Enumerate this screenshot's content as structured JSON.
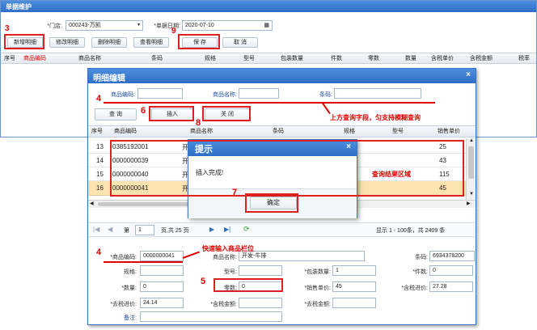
{
  "window": {
    "title": "单据维护"
  },
  "form": {
    "store_label": "*门店:",
    "store_value": "000243-万凯",
    "date_label": "*单据日期:",
    "date_value": "2020-07-10"
  },
  "toolbar": [
    "新增明细",
    "修改明细",
    "删除明细",
    "查看明细",
    "保 存",
    "取 消"
  ],
  "main_table": {
    "headers": [
      "序号",
      "商品编码",
      "商品名称",
      "条码",
      "规格",
      "型号",
      "包装数量",
      "件数",
      "零数",
      "数量",
      "含税单价",
      "含税金额",
      "税率"
    ]
  },
  "dialog": {
    "title": "明细编辑",
    "search": {
      "code_label": "商品编码:",
      "name_label": "商品名称:",
      "barcode_label": "条码:"
    },
    "buttons": {
      "query": "查 询",
      "insert": "插入",
      "close": "关 闭"
    },
    "table": {
      "headers": [
        "序号",
        "商品编码",
        "商品名称",
        "条码",
        "规格",
        "型号",
        "销售单价"
      ],
      "rows": [
        {
          "no": "13",
          "code": "0385192001",
          "name": "开",
          "price": "25"
        },
        {
          "no": "14",
          "code": "0000000039",
          "name": "开",
          "price": "43"
        },
        {
          "no": "15",
          "code": "0000000040",
          "name": "开",
          "price": "115"
        },
        {
          "no": "16",
          "code": "0000000041",
          "name": "开",
          "price": "45"
        }
      ]
    },
    "pager": {
      "page_prefix": "第",
      "page_value": "1",
      "page_suffix": "页,共 25 页",
      "info": "显示 1 - 100条，共 2409 条"
    },
    "detail": {
      "code_label": "*商品编码:",
      "code_value": "0000000041",
      "name_label": "商品名称:",
      "name_value": "开发-牛排",
      "barcode_label": "条码:",
      "barcode_value": "6934378200",
      "spec_label": "规格:",
      "spec_value": "",
      "model_label": "型号:",
      "model_value": "",
      "pack_label": "*包装数量:",
      "pack_value": "1",
      "pieces_label": "*件数:",
      "pieces_value": "0",
      "qty_label": "*数量:",
      "qty_value": "0",
      "loose_label": "零数:",
      "loose_value": "0",
      "price_label": "*销售单价:",
      "price_value": "45",
      "taxprice_label": "*含税进价:",
      "taxprice_value": "27.28",
      "notaxprice_label": "*去税进价:",
      "notaxprice_value": "24.14",
      "taxamt_label": "*含税金额:",
      "taxamt_value": "",
      "notaxamt_label": "*去税金额:",
      "notaxamt_value": "",
      "note_label": "备注:",
      "note_value": ""
    }
  },
  "popup": {
    "title": "提示",
    "message": "插入完成!",
    "ok": "确定"
  },
  "annotations": {
    "n3": "3",
    "n9": "9",
    "n4a": "4",
    "n6": "6",
    "n8": "8",
    "n7": "7",
    "n4b": "4",
    "n5": "5",
    "search_hint": "上方查询字段，匀支持模糊查询",
    "result_hint": "查询结果区域",
    "quick_hint": "快速输入商品栏位"
  },
  "colors": {
    "title_bar": "#2e6fc4",
    "annotation": "#e00000",
    "highlight_row": "#fbe3b0"
  }
}
